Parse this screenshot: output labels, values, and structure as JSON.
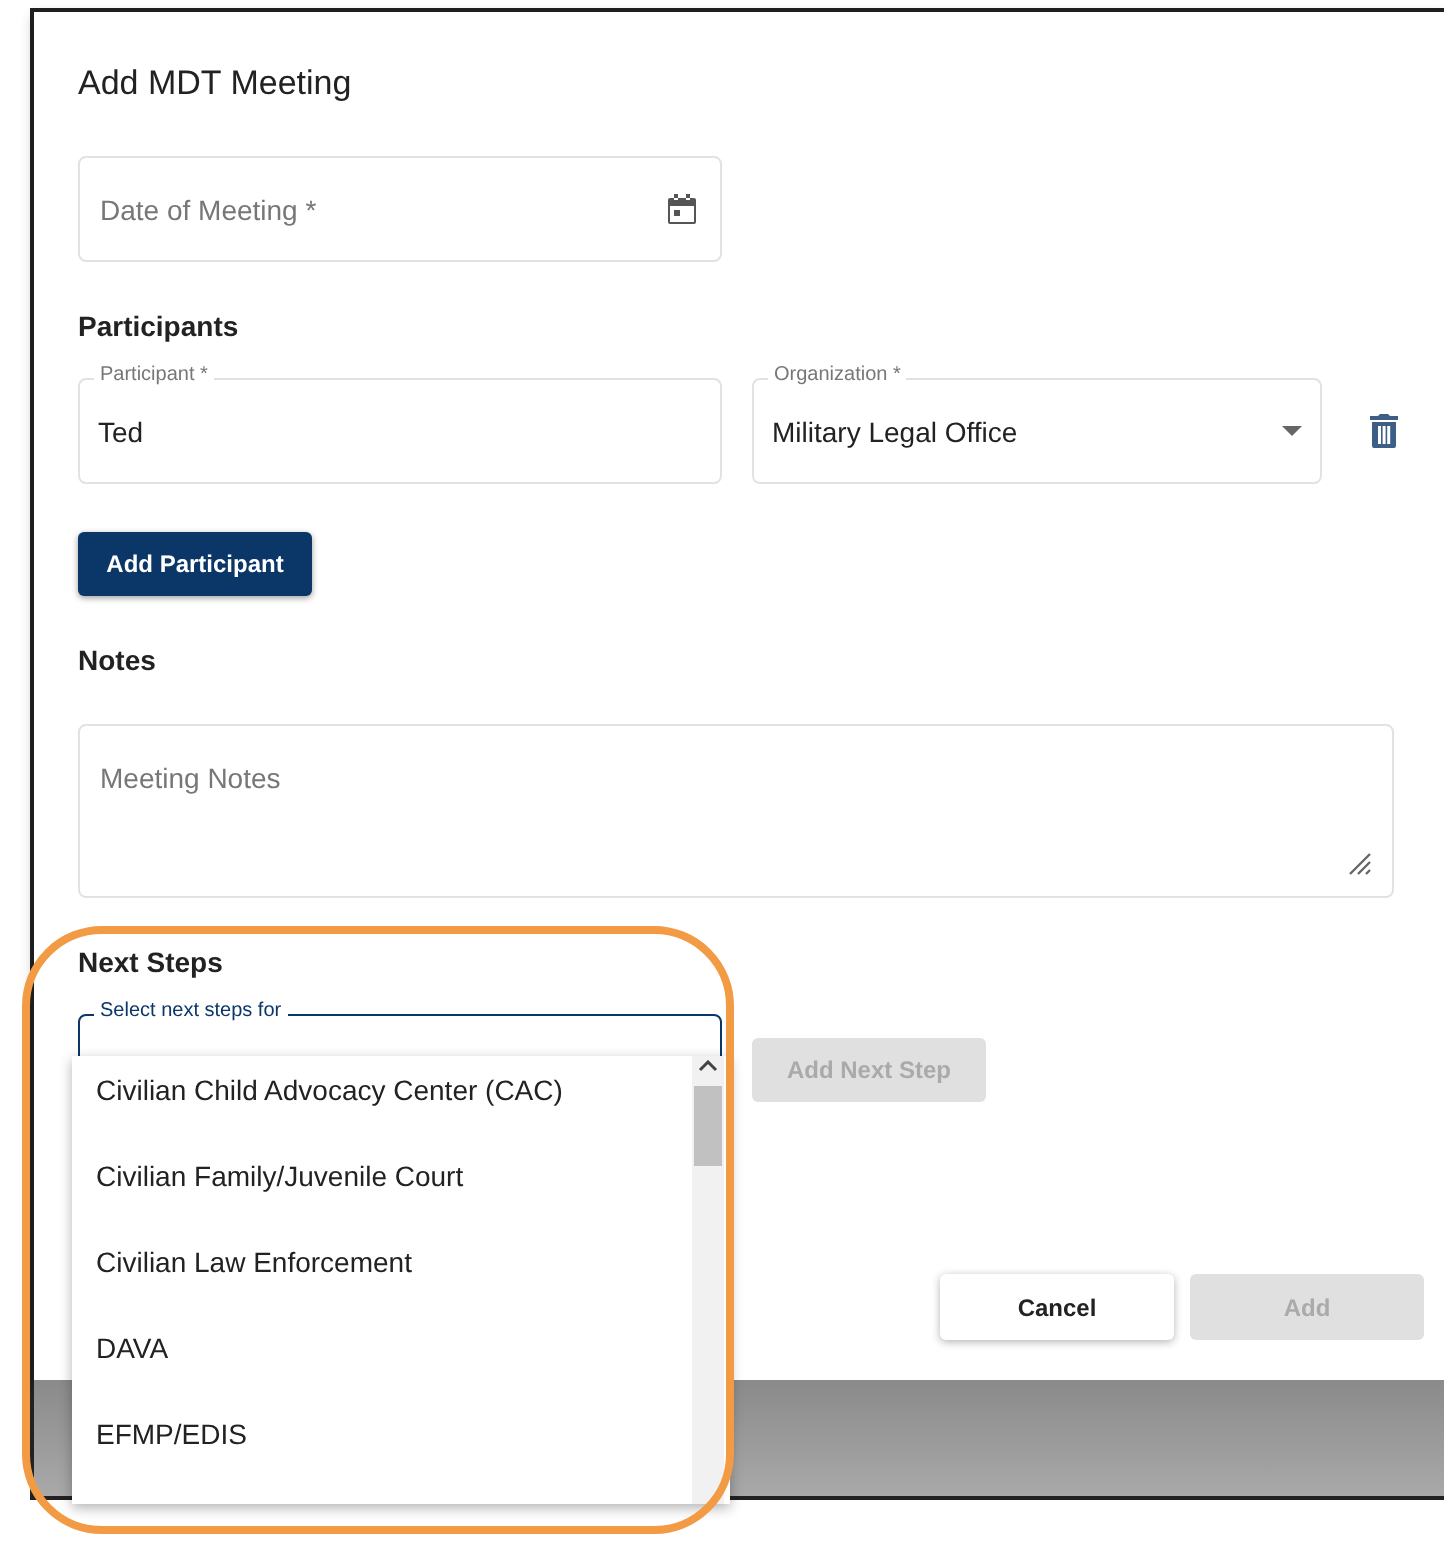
{
  "dialog": {
    "title": "Add MDT Meeting",
    "date_field": {
      "placeholder": "Date of Meeting *"
    },
    "participants_heading": "Participants",
    "participant_field": {
      "label": "Participant *",
      "value": "Ted"
    },
    "organization_field": {
      "label": "Organization *",
      "value": "Military Legal Office"
    },
    "add_participant_button": {
      "label": "Add Participant",
      "disabled": false
    },
    "notes_heading": "Notes",
    "notes_field": {
      "placeholder": "Meeting Notes"
    },
    "next_steps_heading": "Next Steps",
    "next_steps_field": {
      "label": "Select next steps for"
    },
    "add_next_step_button": {
      "label": "Add Next Step",
      "disabled": true
    },
    "buttons": [
      {
        "label": "Cancel",
        "disabled": false
      },
      {
        "label": "Add",
        "disabled": true
      }
    ]
  },
  "dropdown": {
    "options": [
      "Civilian Child Advocacy Center (CAC)",
      "Civilian Family/Juvenile Court",
      "Civilian Law Enforcement",
      "DAVA",
      "EFMP/EDIS"
    ]
  }
}
